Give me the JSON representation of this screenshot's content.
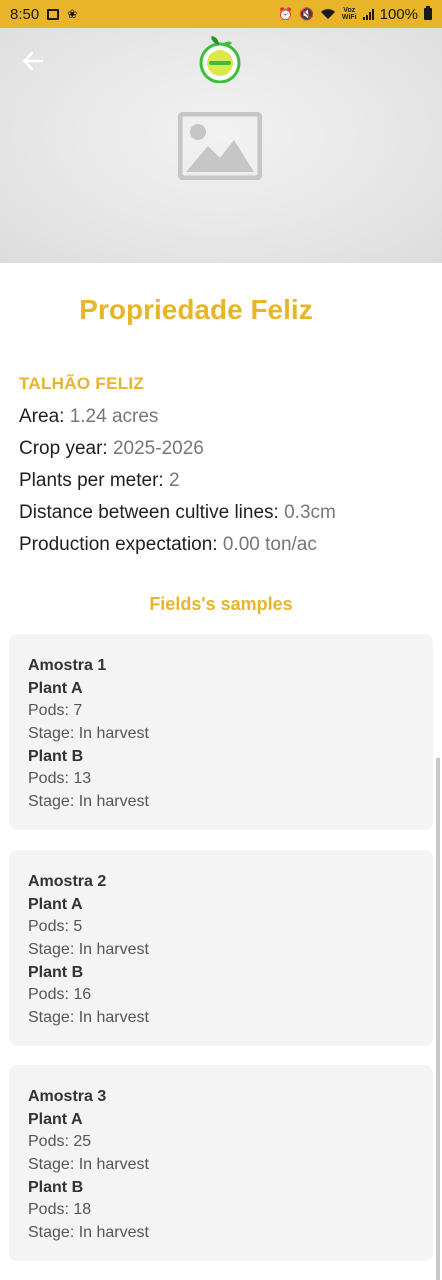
{
  "status_bar": {
    "time": "8:50",
    "voz_top": "Voz",
    "voz_bottom": "WiFi",
    "battery": "100%"
  },
  "header": {
    "back_icon": "arrow-left-icon",
    "logo": "app-logo",
    "image_placeholder": "image-placeholder-icon"
  },
  "property": {
    "title": "Propriedade Feliz"
  },
  "field": {
    "name": "TALHÃO FELIZ",
    "rows": [
      {
        "label": "Area:",
        "value": "1.24 acres"
      },
      {
        "label": "Crop year:",
        "value": "2025-2026"
      },
      {
        "label": "Plants per meter:",
        "value": "2"
      },
      {
        "label": "Distance between cultive lines:",
        "value": "0.3cm"
      },
      {
        "label": "Production expectation:",
        "value": "0.00 ton/ac"
      }
    ]
  },
  "samples": {
    "title": "Fields's samples",
    "items": [
      {
        "name": "Amostra 1",
        "plant_a": {
          "label": "Plant A",
          "pods": "Pods: 7",
          "stage": "Stage: In harvest"
        },
        "plant_b": {
          "label": "Plant B",
          "pods": "Pods: 13",
          "stage": "Stage: In harvest"
        }
      },
      {
        "name": "Amostra 2",
        "plant_a": {
          "label": "Plant A",
          "pods": "Pods: 5",
          "stage": "Stage: In harvest"
        },
        "plant_b": {
          "label": "Plant B",
          "pods": "Pods: 16",
          "stage": "Stage: In harvest"
        }
      },
      {
        "name": "Amostra 3",
        "plant_a": {
          "label": "Plant A",
          "pods": "Pods: 25",
          "stage": "Stage: In harvest"
        },
        "plant_b": {
          "label": "Plant B",
          "pods": "Pods: 18",
          "stage": "Stage: In harvest"
        }
      }
    ]
  },
  "colors": {
    "accent": "#E8B52A",
    "status_bar": "#E8B52A",
    "card_bg": "#F4F4F4",
    "logo_green": "#3DBE3B"
  }
}
